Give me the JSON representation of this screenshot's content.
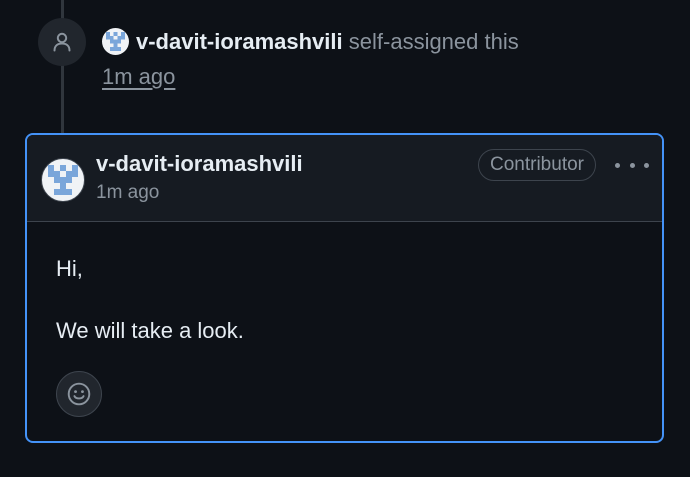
{
  "event": {
    "user": "v-davit-ioramashvili",
    "action": "self-assigned this",
    "time": "1m ago"
  },
  "comment": {
    "author": "v-davit-ioramashvili",
    "time": "1m ago",
    "badge": "Contributor",
    "body": [
      "Hi,",
      "We will take a look."
    ]
  },
  "icons": {
    "event": "person-icon",
    "more": "kebab-horizontal-icon",
    "reaction": "smiley-icon"
  },
  "colors": {
    "background": "#0d1117",
    "header_background": "#161b22",
    "accent_border": "#4493f8",
    "muted_text": "#8b949e",
    "avatar_pattern": "#7aa6da"
  }
}
